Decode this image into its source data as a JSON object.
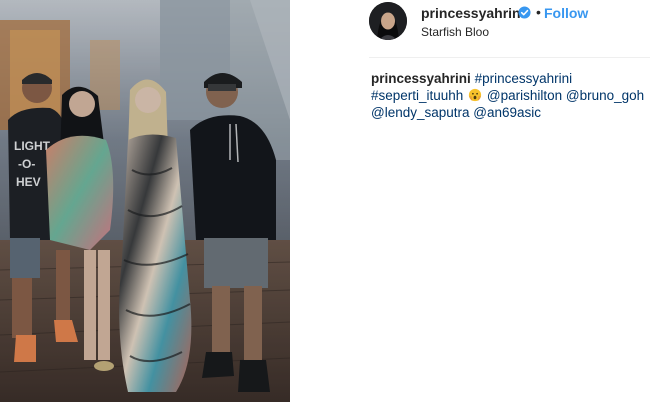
{
  "post": {
    "username": "princessyahrini",
    "follow_label": "Follow",
    "separator": "•",
    "location": "Starfish Bloo",
    "verified_icon": "verified-badge-icon",
    "accent_color": "#3897f0",
    "link_color": "#003569"
  },
  "caption": {
    "author": "princessyahrini",
    "hashtag_1": "#princessyahrini",
    "hashtag_2": "#seperti_ituuhh",
    "emoji": "face-with-hands-on-cheeks-emoji",
    "mention_1": "@parishilton",
    "mention_2": "@bruno_goh",
    "mention_3": "@lendy_saputra",
    "mention_4": "@an69asic"
  }
}
